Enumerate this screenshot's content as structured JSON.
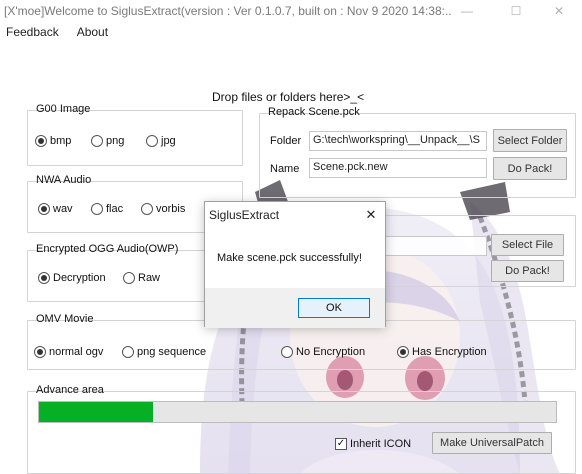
{
  "window": {
    "title": "[X'moe]Welcome to SiglusExtract(version : Ver 0.1.0.7, built on : Nov  9 2020 14:38:...",
    "minimize": "—",
    "maximize": "☐",
    "close": "✕"
  },
  "menu": [
    "Feedback",
    "About"
  ],
  "drop_hint": "Drop files or folders here>_<",
  "g00": {
    "title": "G00 Image",
    "options": [
      "bmp",
      "png",
      "jpg"
    ],
    "selected": 0
  },
  "repack": {
    "title": "Repack Scene.pck",
    "folder_label": "Folder",
    "folder_value": "G:\\tech\\workspring\\__Unpack__\\S",
    "select_folder": "Select Folder",
    "name_label": "Name",
    "name_value": "Scene.pck.new",
    "do_pack": "Do Pack!"
  },
  "nwa": {
    "title": "NWA Audio",
    "options": [
      "wav",
      "flac",
      "vorbis"
    ],
    "selected": 0
  },
  "second_pack": {
    "select_file": "Select File",
    "do_pack": "Do Pack!"
  },
  "ogg": {
    "title": "Encrypted OGG Audio(OWP)",
    "options": [
      "Decryption",
      "Raw"
    ],
    "selected": 0
  },
  "omv": {
    "title": "OMV Movie",
    "options": [
      "normal ogv",
      "png sequence"
    ],
    "selected": 0
  },
  "encryption": {
    "options": [
      "No Encryption",
      "Has Encryption"
    ],
    "selected": 1
  },
  "advance": {
    "title": "Advance area",
    "progress": 0.22,
    "inherit_icon": "Inherit ICON",
    "inherit_checked": true,
    "make_universal": "Make UniversalPatch"
  },
  "dialog": {
    "title": "SiglusExtract",
    "message": "Make scene.pck successfully!",
    "ok": "OK",
    "close": "✕"
  },
  "colors": {
    "progress_fill": "#06b025",
    "ok_border": "#0078d7"
  }
}
